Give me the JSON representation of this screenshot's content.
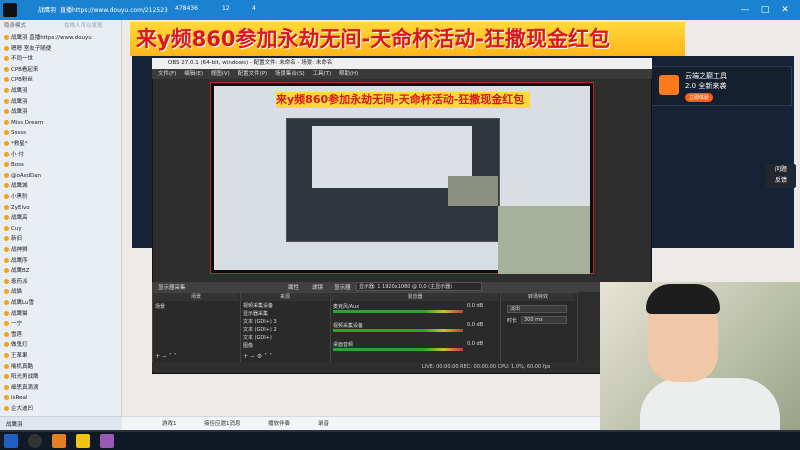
{
  "titlebar": {
    "app_name": "战鹰羽",
    "url_text": "直播https://www.douyu.com/212523",
    "count": "478436",
    "badge1": "12",
    "badge2": "4",
    "minimize": "—",
    "maximize": "□",
    "close": "✕"
  },
  "sidebar": {
    "status": "隐身模式",
    "search": "在线人可以发现",
    "items": [
      "战鹰羽 直播https://www.douyu",
      "嗯嗯  室友子随便",
      "不同一世",
      "CPB看起来",
      "CPB粉丝",
      "战鹰羽",
      "战鹰羽",
      "战鹰羽",
      "Miss Dream",
      "Sssss",
      "*救星*",
      "小 付",
      "Boss",
      "@oAsdDan",
      "战鹰城",
      "小黑豹",
      "ZyEivo",
      "战鹰高",
      "Cuy",
      "新旧",
      "战神狮",
      "战鹰序",
      "战鹰BZ",
      "患药派",
      "战猫",
      "战鹰Lu雪",
      "战鹰猫",
      "一宁",
      "雪莲",
      "做鬼灯",
      "王革果",
      "喻机真酷",
      "阳光男战鹰",
      "细思真滴滴",
      "IsReal",
      "企大迪凹"
    ],
    "bottom": "战鹰羽"
  },
  "banner": {
    "text": "来y频860参加永劫无间-天命杯活动-狂撒现金红包"
  },
  "promo": {
    "line1": "云端之巅工具",
    "line2": "2.0 全新来袭",
    "button": "立即体验"
  },
  "obs": {
    "title": "OBS 27.0.1 (64-bit, windows) - 配置文件: 未命名 - 场景: 未命名",
    "menu": [
      "文件(F)",
      "编辑(E)",
      "视图(V)",
      "配置文件(P)",
      "场景集合(S)",
      "工具(T)",
      "帮助(H)"
    ],
    "source_bar": "显示器采集",
    "props": "属性",
    "filters": "滤镜",
    "display_label": "显示器",
    "display_value": "显示器: 1 1920x1080 @ 0,0 (主显示器)",
    "scenes_header": "场景",
    "scenes": [
      "场景"
    ],
    "sources_header": "来源",
    "sources": [
      "视频采集设备",
      "显示器采集",
      "文本 (GDI+) 3",
      "文本 (GDI+) 2",
      "文本 (GDI+)",
      "图像"
    ],
    "mixer_header": "混音器",
    "mixer": [
      {
        "name": "麦克风/Aux",
        "db": "0.0 dB"
      },
      {
        "name": "视频采集设备",
        "db": "0.0 dB"
      },
      {
        "name": "桌面音频",
        "db": "0.0 dB"
      }
    ],
    "transition_header": "转场特效",
    "transition": "淡出",
    "duration_label": "时长",
    "duration": "300 ms",
    "status": "LIVE: 00:00:00   REC: 00:00:00   CPU: 1.0%, 60.00 fps"
  },
  "chat_bar": {
    "item1": "游戏1",
    "item2": "接佳应邀1消息",
    "item3": "播放伴奏",
    "item4": "录音"
  },
  "side_chip": {
    "line1": "问题",
    "line2": "反馈"
  }
}
